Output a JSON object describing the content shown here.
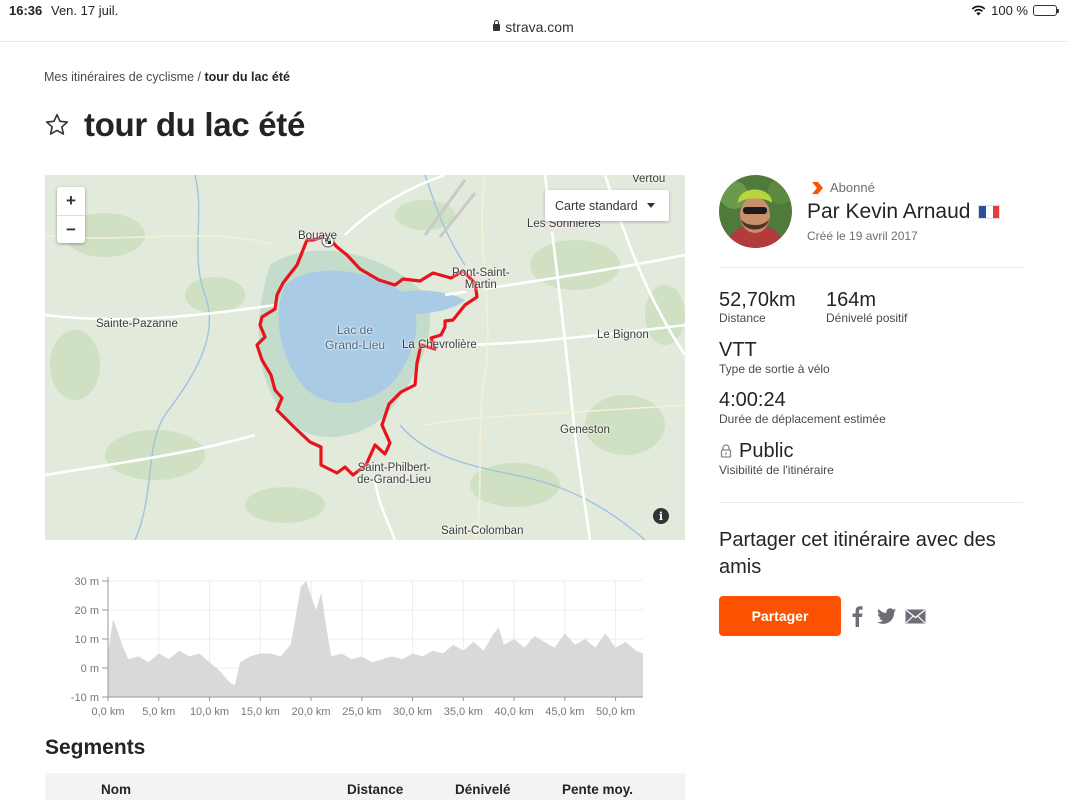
{
  "status_bar": {
    "time": "16:36",
    "date": "Ven. 17 juil.",
    "url": "strava.com",
    "battery": "100 %",
    "battery_level": 1.0
  },
  "breadcrumb": {
    "parent": "Mes itinéraires de cyclisme",
    "separator": "/",
    "current": "tour du lac été"
  },
  "title": "tour du lac été",
  "map": {
    "zoom_in": "+",
    "zoom_out": "−",
    "map_type": "Carte standard",
    "info": "i",
    "labels": {
      "vertou": "Vertou",
      "bouaye": "Bouaye",
      "sorinieres": "Les Sorinières",
      "pont_saint_martin": "Pont-Saint-\nMartin",
      "sainte_pazanne": "Sainte-Pazanne",
      "lac": "Lac de\nGrand-Lieu",
      "chevroliere": "La Chevrolière",
      "bignon": "Le Bignon",
      "geneston": "Geneston",
      "saint_philbert": "Saint-Philbert-\nde-Grand-Lieu",
      "saint_colomban": "Saint-Colomban"
    }
  },
  "elevation": {
    "y_ticks": [
      "30 m",
      "20 m",
      "10 m",
      "0 m",
      "-10 m"
    ],
    "x_ticks": [
      "0,0 km",
      "5,0 km",
      "10,0 km",
      "15,0 km",
      "20,0 km",
      "25,0 km",
      "30,0 km",
      "35,0 km",
      "40,0 km",
      "45,0 km",
      "50,0 km"
    ]
  },
  "chart_data": {
    "type": "area",
    "xlabel": "",
    "ylabel": "",
    "xlim": [
      0,
      52.7
    ],
    "ylim": [
      -10,
      30
    ],
    "x": [
      0,
      0.5,
      1,
      1.5,
      2,
      3,
      4,
      5,
      6,
      7,
      8,
      9,
      10,
      11,
      12,
      12.5,
      13,
      14,
      15,
      16,
      17,
      18,
      19,
      19.5,
      20,
      20.5,
      21,
      21.5,
      22,
      23,
      24,
      25,
      26,
      27,
      28,
      29,
      30,
      31,
      32,
      33,
      34,
      35,
      36,
      37,
      38,
      38.5,
      39,
      40,
      41,
      42,
      43,
      44,
      45,
      46,
      47,
      48,
      49,
      50,
      51,
      52,
      52.7
    ],
    "values": [
      5,
      17,
      12,
      7,
      3,
      4,
      2,
      5,
      3,
      6,
      4,
      5,
      2,
      -1,
      -5,
      -6,
      2,
      4,
      5,
      5,
      4,
      8,
      28,
      30,
      25,
      20,
      26,
      14,
      4,
      5,
      3,
      4,
      2,
      3,
      4,
      3,
      5,
      4,
      6,
      5,
      8,
      6,
      9,
      6,
      12,
      14,
      8,
      10,
      7,
      11,
      9,
      7,
      12,
      8,
      10,
      7,
      12,
      7,
      9,
      6,
      5
    ]
  },
  "segments": {
    "title": "Segments",
    "columns": [
      "Nom",
      "Distance",
      "Dénivelé",
      "Pente moy."
    ]
  },
  "author": {
    "subscriber_label": "Abonné",
    "name": "Par Kevin Arnaud",
    "created": "Créé le 19 avril 2017"
  },
  "stats": {
    "distance": {
      "value": "52,70km",
      "label": "Distance"
    },
    "elevation_gain": {
      "value": "164m",
      "label": "Dénivelé positif"
    },
    "bike_type": {
      "value": "VTT",
      "label": "Type de sortie à vélo"
    },
    "moving_time": {
      "value": "4:00:24",
      "label": "Durée de déplacement estimée"
    },
    "visibility": {
      "value": "Public",
      "label": "Visibilité de l'itinéraire"
    }
  },
  "share": {
    "title": "Partager cet itinéraire avec des amis",
    "button": "Partager",
    "icons": [
      "facebook-icon",
      "twitter-icon",
      "email-icon"
    ]
  },
  "colors": {
    "accent": "#fc5200",
    "route": "#e8141b",
    "lake": "#a9cbe5",
    "map_land": "#e2eadb",
    "chart_fill": "#d9d9d9"
  }
}
